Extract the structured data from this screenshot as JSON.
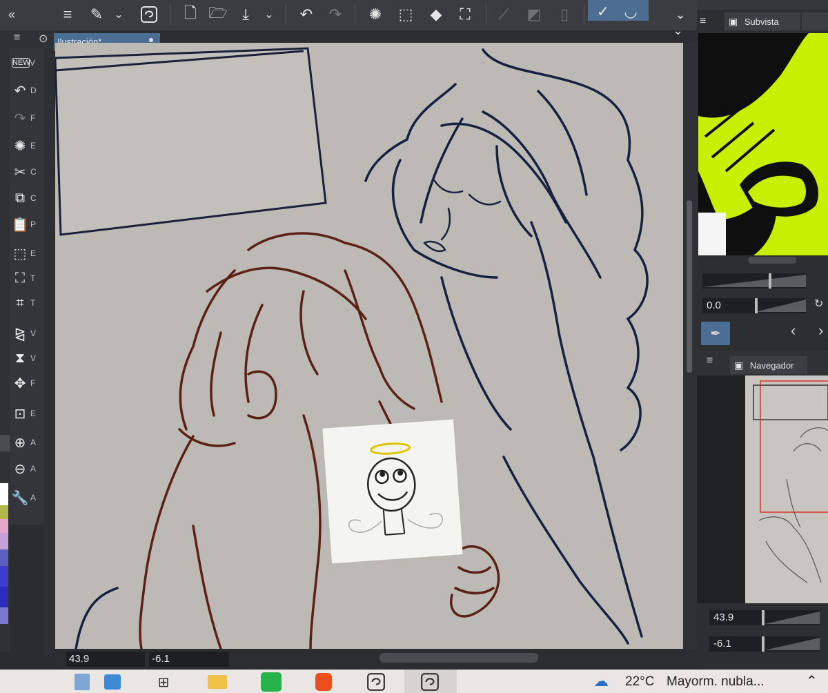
{
  "app": {
    "toolbar": {
      "icons": [
        "collapse-icon",
        "menu-icon",
        "edit-brush-icon",
        "chevron-down-icon",
        "app-logo-icon",
        "new-file-icon",
        "open-folder-icon",
        "save-icon",
        "chevron-down-icon",
        "undo-icon",
        "redo-icon",
        "loading-icon",
        "select-icon",
        "fill-icon",
        "transform-icon",
        "ruler-icon",
        "mask-icon",
        "frame-icon",
        "snap-ruler-icon",
        "snap-special-icon",
        "collapse-down-icon"
      ]
    },
    "document_tab": {
      "label": "Ilustración*"
    },
    "tools": [
      {
        "icon": "new-icon",
        "letter": "V"
      },
      {
        "icon": "undo-icon",
        "letter": "D"
      },
      {
        "icon": "redo-icon",
        "letter": "F"
      },
      {
        "icon": "clear-icon",
        "letter": "E"
      },
      {
        "icon": "cut-icon",
        "letter": "C"
      },
      {
        "icon": "copy-icon",
        "letter": "C"
      },
      {
        "icon": "paste-icon",
        "letter": "P"
      },
      {
        "icon": "select-area-icon",
        "letter": "E"
      },
      {
        "icon": "transform-icon",
        "letter": "T"
      },
      {
        "icon": "scale-icon",
        "letter": "T"
      },
      {
        "icon": "flip-horizontal-icon",
        "letter": "V"
      },
      {
        "icon": "flip-vertical-icon",
        "letter": "V"
      },
      {
        "icon": "move-icon",
        "letter": "F"
      },
      {
        "icon": "ruler-icon",
        "letter": "E"
      },
      {
        "icon": "zoom-in-icon",
        "letter": "A"
      },
      {
        "icon": "zoom-out-icon",
        "letter": "A"
      },
      {
        "icon": "settings-icon",
        "letter": "A"
      }
    ],
    "status": {
      "zoom": "43.9",
      "rotation": "-6.1"
    },
    "subview_panel": {
      "title": "Subvista",
      "value": "0.0"
    },
    "navigator_panel": {
      "title": "Navegador",
      "zoom": "43.9",
      "rotation": "-6.1"
    },
    "taskbar": {
      "weather_temp": "22°C",
      "weather_desc": "Mayorm. nubla...",
      "apps": [
        "file-icon",
        "store-icon",
        "task-view-icon",
        "folder-icon",
        "whatsapp-icon",
        "brave-icon",
        "app-logo-icon",
        "app-logo-icon"
      ]
    },
    "colors": {
      "accent": "#4d6e93",
      "canvas": "#bdbab5",
      "lime": "#c7f000"
    }
  }
}
